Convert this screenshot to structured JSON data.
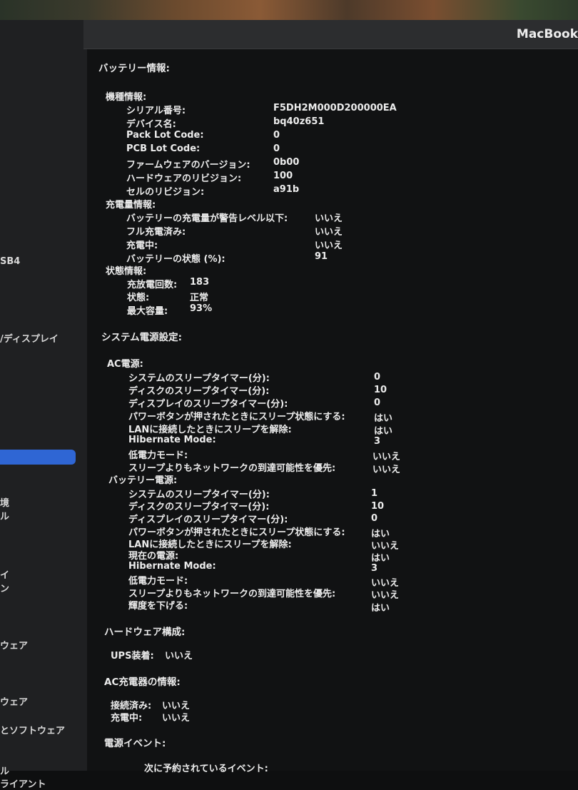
{
  "window": {
    "title": "MacBook"
  },
  "sidebar": {
    "items": [
      "SB4",
      "/ディスプレイ",
      "境",
      "ル",
      "イ",
      "ン",
      "ウェア",
      "ウェア",
      "とソフトウェア",
      "ル",
      "ライアント"
    ]
  },
  "battery": {
    "heading": "バッテリー情報:",
    "model_heading": "機種情報:",
    "model": [
      {
        "label": "シリアル番号:",
        "value": "F5DH2M000D200000EA"
      },
      {
        "label": "デバイス名:",
        "value": "bq40z651"
      },
      {
        "label": "Pack Lot Code:",
        "value": "0"
      },
      {
        "label": "PCB Lot Code:",
        "value": "0"
      },
      {
        "label": "ファームウェアのバージョン:",
        "value": "0b00"
      },
      {
        "label": "ハードウェアのリビジョン:",
        "value": "100"
      },
      {
        "label": "セルのリビジョン:",
        "value": "a91b"
      }
    ],
    "charge_heading": "充電量情報:",
    "charge": [
      {
        "label": "バッテリーの充電量が警告レベル以下:",
        "value": "いいえ"
      },
      {
        "label": "フル充電済み:",
        "value": "いいえ"
      },
      {
        "label": "充電中:",
        "value": "いいえ"
      },
      {
        "label": "バッテリーの状態 (%):",
        "value": "91"
      }
    ],
    "health_heading": "状態情報:",
    "health": [
      {
        "label": "充放電回数:",
        "value": "183"
      },
      {
        "label": "状態:",
        "value": "正常"
      },
      {
        "label": "最大容量:",
        "value": "93%"
      }
    ]
  },
  "power": {
    "heading": "システム電源設定:",
    "ac_heading": "AC電源:",
    "ac": [
      {
        "label": "システムのスリープタイマー(分):",
        "value": "0"
      },
      {
        "label": "ディスクのスリープタイマー(分):",
        "value": "10"
      },
      {
        "label": "ディスプレイのスリープタイマー(分):",
        "value": "0"
      },
      {
        "label": "パワーボタンが押されたときにスリープ状態にする:",
        "value": "はい"
      },
      {
        "label": "LANに接続したときにスリープを解除:",
        "value": "はい"
      },
      {
        "label": "Hibernate Mode:",
        "value": "3"
      },
      {
        "label": "低電力モード:",
        "value": "いいえ"
      },
      {
        "label": "スリープよりもネットワークの到達可能性を優先:",
        "value": "いいえ"
      }
    ],
    "battery_heading": "バッテリー電源:",
    "battery": [
      {
        "label": "システムのスリープタイマー(分):",
        "value": "1"
      },
      {
        "label": "ディスクのスリープタイマー(分):",
        "value": "10"
      },
      {
        "label": "ディスプレイのスリープタイマー(分):",
        "value": "0"
      },
      {
        "label": "パワーボタンが押されたときにスリープ状態にする:",
        "value": "はい"
      },
      {
        "label": "LANに接続したときにスリープを解除:",
        "value": "いいえ"
      },
      {
        "label": "現在の電源:",
        "value": "はい"
      },
      {
        "label": "Hibernate Mode:",
        "value": "3"
      },
      {
        "label": "低電力モード:",
        "value": "いいえ"
      },
      {
        "label": "スリープよりもネットワークの到達可能性を優先:",
        "value": "いいえ"
      },
      {
        "label": "輝度を下げる:",
        "value": "はい"
      }
    ]
  },
  "hardware": {
    "heading": "ハードウェア構成:",
    "ups": {
      "label": "UPS装着:",
      "value": "いいえ"
    }
  },
  "charger": {
    "heading": "AC充電器の情報:",
    "connected": {
      "label": "接続済み:",
      "value": "いいえ"
    },
    "charging": {
      "label": "充電中:",
      "value": "いいえ"
    }
  },
  "events": {
    "heading": "電源イベント:",
    "next": "次に予約されているイベント:"
  }
}
